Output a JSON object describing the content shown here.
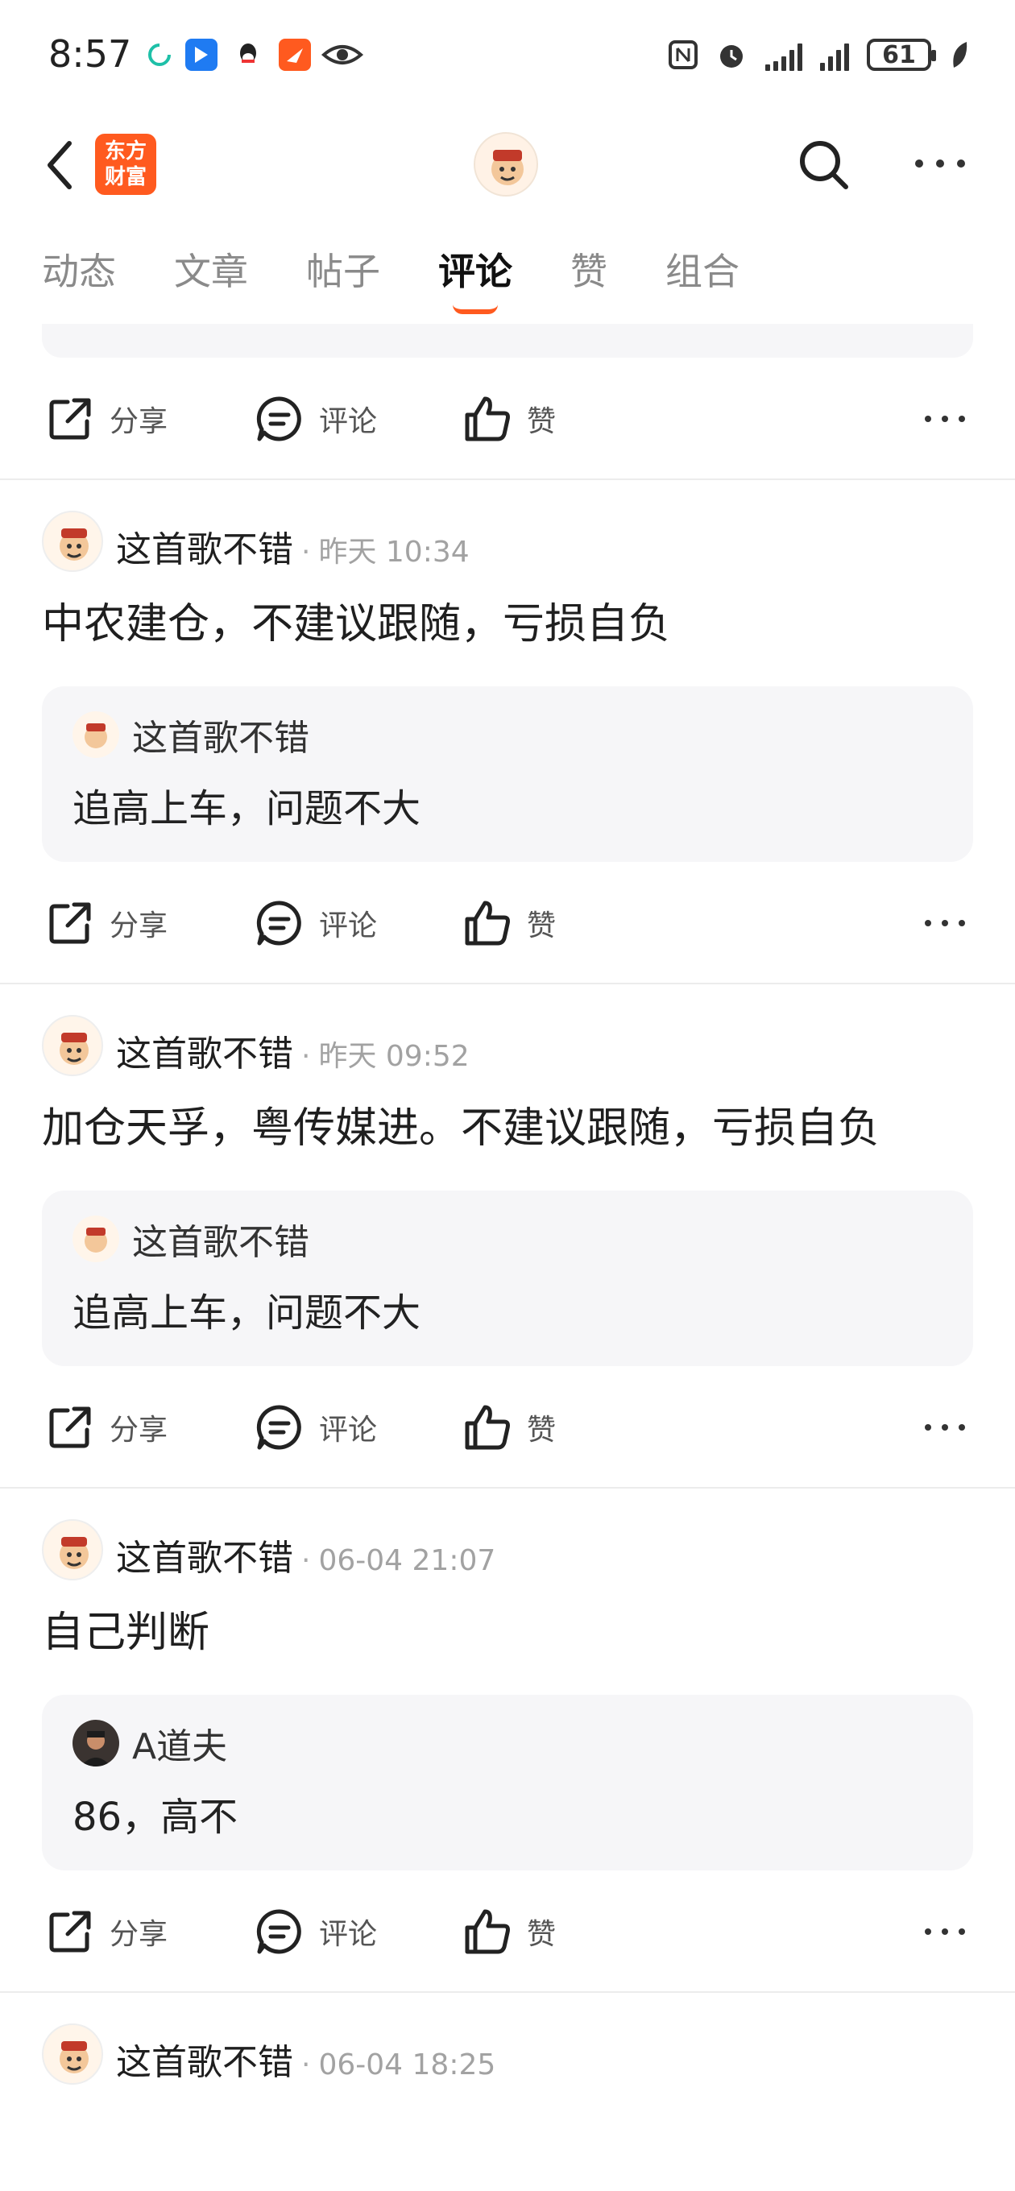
{
  "status_bar": {
    "time": "8:57",
    "battery": "61"
  },
  "header": {
    "brand_line1": "东方",
    "brand_line2": "财富"
  },
  "tabs": [
    {
      "label": "动态"
    },
    {
      "label": "文章"
    },
    {
      "label": "帖子"
    },
    {
      "label": "评论"
    },
    {
      "label": "赞"
    },
    {
      "label": "组合"
    }
  ],
  "actions": {
    "share": "分享",
    "comment": "评论",
    "like": "赞"
  },
  "posts": [
    {
      "author": "这首歌不错",
      "time": "昨天 10:34",
      "text": "中农建仓，不建议跟随，亏损自负",
      "quote": {
        "author": "这首歌不错",
        "text": "追高上车，问题不大"
      }
    },
    {
      "author": "这首歌不错",
      "time": "昨天 09:52",
      "text": "加仓天孚，粤传媒进。不建议跟随，亏损自负",
      "quote": {
        "author": "这首歌不错",
        "text": "追高上车，问题不大"
      }
    },
    {
      "author": "这首歌不错",
      "time": "06-04 21:07",
      "text": "自己判断",
      "quote": {
        "author": "A道夫",
        "text": "86，高不"
      }
    },
    {
      "author": "这首歌不错",
      "time": "06-04 18:25"
    }
  ],
  "colors": {
    "accent": "#ff5a1f",
    "quote_bg": "#f6f6f8"
  }
}
